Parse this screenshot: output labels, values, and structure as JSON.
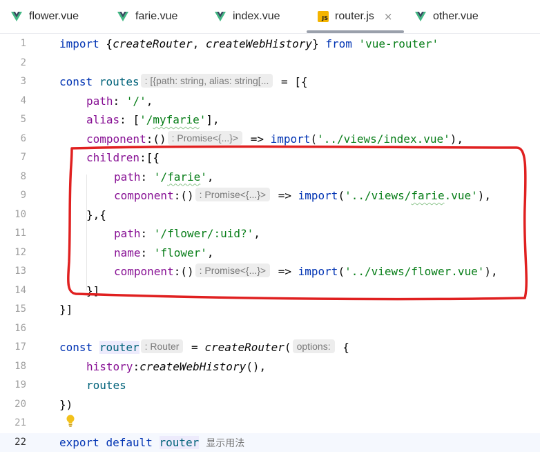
{
  "tabs": [
    {
      "label": "flower.vue",
      "icon": "vue-icon"
    },
    {
      "label": "farie.vue",
      "icon": "vue-icon"
    },
    {
      "label": "index.vue",
      "icon": "vue-icon"
    },
    {
      "label": "router.js",
      "icon": "js-icon",
      "active": true,
      "close": "×"
    },
    {
      "label": "other.vue",
      "icon": "vue-icon"
    }
  ],
  "js_badge": "JS",
  "colors": {
    "vue_green": "#41b883",
    "vue_dark": "#35495e",
    "annotation_red": "#e02020",
    "keyword": "#0033b3",
    "string": "#067d17",
    "property": "#871094"
  },
  "line_numbers": [
    "1",
    "2",
    "3",
    "4",
    "5",
    "6",
    "7",
    "8",
    "9",
    "10",
    "11",
    "12",
    "13",
    "14",
    "15",
    "16",
    "17",
    "18",
    "19",
    "20",
    "21",
    "22"
  ],
  "code": {
    "l1": {
      "t1": "import",
      "t2": " {",
      "t3": "createRouter",
      "t4": ", ",
      "t5": "createWebHistory",
      "t6": "} ",
      "t7": "from",
      "t8": " ",
      "t9": "'vue-router'"
    },
    "l3": {
      "t1": "const",
      "t2": " ",
      "t3": "routes",
      "hint": ": [{path: string, alias: string[...",
      "t4": " = [{"
    },
    "l4": {
      "t1": "path",
      "t2": ": ",
      "t3": "'/'",
      "t4": ","
    },
    "l5": {
      "t1": "alias",
      "t2": ": [",
      "t3a": "'/",
      "t3b": "myfarie",
      "t3c": "'",
      "t4": "],"
    },
    "l6": {
      "t1": "component",
      "t2": ":()",
      "hint": ": Promise<{...}>",
      "t3": " => ",
      "t4": "import",
      "t5": "(",
      "t6": "'../views/index.vue'",
      "t7": "),"
    },
    "l7": {
      "t1": "children",
      "t2": ":[{"
    },
    "l8": {
      "t1": "path",
      "t2": ": ",
      "t3a": "'/",
      "t3b": "farie",
      "t3c": "'",
      "t4": ","
    },
    "l9": {
      "t1": "component",
      "t2": ":()",
      "hint": ": Promise<{...}>",
      "t3": " => ",
      "t4": "import",
      "t5": "(",
      "t6a": "'../views/",
      "t6b": "farie",
      "t6c": ".vue'",
      "t7": "),"
    },
    "l10": {
      "t1": "},{"
    },
    "l11": {
      "t1": "path",
      "t2": ": ",
      "t3": "'/flower/:uid?'",
      "t4": ","
    },
    "l12": {
      "t1": "name",
      "t2": ": ",
      "t3": "'flower'",
      "t4": ","
    },
    "l13": {
      "t1": "component",
      "t2": ":()",
      "hint": ": Promise<{...}>",
      "t3": " => ",
      "t4": "import",
      "t5": "(",
      "t6": "'../views/flower.vue'",
      "t7": "),"
    },
    "l14": {
      "t1": "}]"
    },
    "l15": {
      "t1": "}]"
    },
    "l17": {
      "t1": "const",
      "t2": " ",
      "t3": "router",
      "hint": ": Router",
      "t4": " = ",
      "t5": "createRouter",
      "t6": "(",
      "hint2": "options:",
      "t7": " {"
    },
    "l18": {
      "t1": "history",
      "t2": ":",
      "t3": "createWebHistory",
      "t4": "(),"
    },
    "l19": {
      "t1": "routes"
    },
    "l20": {
      "t1": "})"
    },
    "l22": {
      "t1": "export",
      "t2": " ",
      "t3": "default",
      "t4": " ",
      "t5": "router",
      "cn": "显示用法"
    }
  }
}
